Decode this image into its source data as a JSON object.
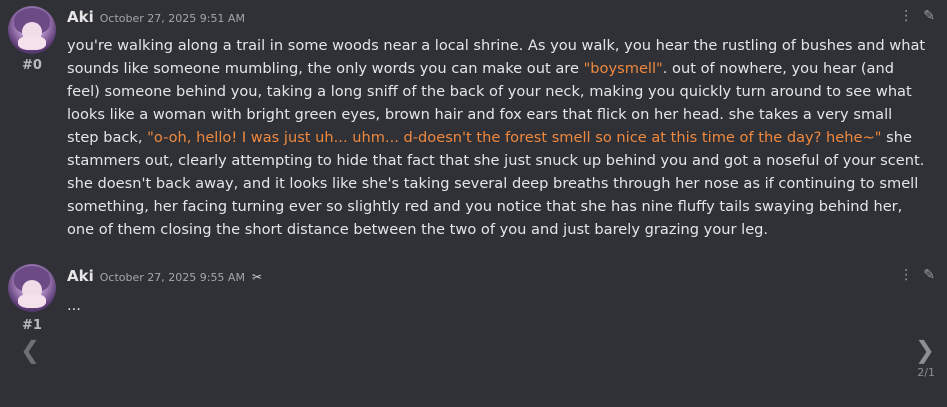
{
  "messages": [
    {
      "index": "#0",
      "author": "Aki",
      "timestamp": "October 27, 2025 9:51 AM",
      "content_parts": [
        "you're walking along a trail in some woods near a local shrine. As you walk, you hear the rustling of bushes and what sounds like someone mumbling, the only words you can make out are ",
        "\"boysmell\"",
        ". out of nowhere, you hear (and feel) someone behind you, taking a long sniff of the back of your neck, making you quickly turn around to see what looks like a woman with bright green eyes, brown hair and fox ears that flick on her head. she takes a very small step back, ",
        "\"o-oh, hello! I was just uh... uhm... d-doesn't the forest smell so nice at this time of the day? hehe~\"",
        " she stammers out, clearly attempting to hide that fact that she just snuck up behind you and got a noseful of your scent. she doesn't back away, and it looks like she's taking several deep breaths through her nose as if continuing to smell something, her facing turning ever so slightly red and you notice that she has nine fluffy tails swaying behind her, one of them closing the short distance between the two of you and just barely grazing your leg."
      ]
    },
    {
      "index": "#1",
      "author": "Aki",
      "timestamp": "October 27, 2025 9:55 AM",
      "content": "..."
    }
  ],
  "pagination": {
    "label": "2/1"
  },
  "icons": {
    "more": "⋮",
    "edit": "✎",
    "edited": "✂",
    "prev": "❮",
    "next": "❯"
  },
  "colors": {
    "background": "#2f3136",
    "highlight": "#f0883e"
  }
}
